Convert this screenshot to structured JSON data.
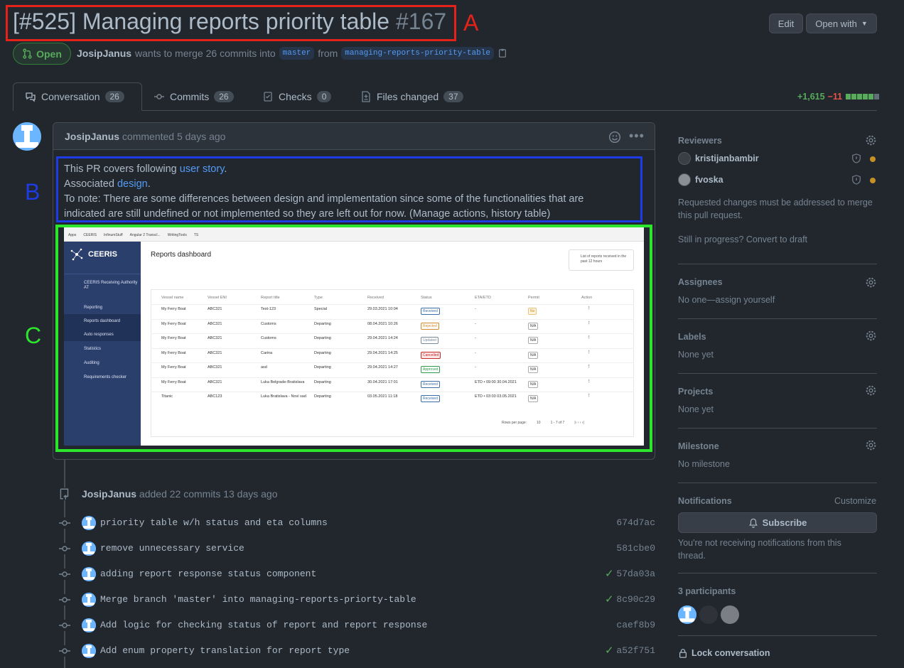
{
  "header": {
    "title": "[#525] Managing reports priority table",
    "number": "#167",
    "edit_label": "Edit",
    "open_with_label": "Open with",
    "state_label": "Open",
    "author": "JosipJanus",
    "merge_text_1": "wants to merge 26 commits into",
    "base_branch": "master",
    "merge_text_2": "from",
    "head_branch": "managing-reports-priority-table"
  },
  "annotations": {
    "a": "A",
    "b": "B",
    "c": "C"
  },
  "tabs": [
    {
      "label": "Conversation",
      "count": "26"
    },
    {
      "label": "Commits",
      "count": "26"
    },
    {
      "label": "Checks",
      "count": "0"
    },
    {
      "label": "Files changed",
      "count": "37"
    }
  ],
  "diffstat": {
    "additions": "+1,615",
    "deletions": "−11"
  },
  "comment": {
    "author": "JosipJanus",
    "meta": "commented 5 days ago",
    "line1_pre": "This PR covers following ",
    "line1_link": "user story",
    "line1_post": ".",
    "line2_pre": "Associated ",
    "line2_link": "design",
    "line2_post": ".",
    "line3": "To note: There are some differences between design and implementation since some of the functionalities that are",
    "line4": "indicated are still undefined or not implemented so they are left out for now. (Manage actions, history table)"
  },
  "embedded_screenshot": {
    "bookmarks": [
      "Apps",
      "CEERIS",
      "InfinumStuff",
      "Angular 2 Transcl...",
      "WritingTools",
      "TS"
    ],
    "brand": "CEERIS",
    "user": "CEERIS Receiving Authority AT",
    "sidebar": [
      "Reporting",
      "Reports dashboard",
      "Auto responses",
      "Statistics",
      "Auditing",
      "Requirements checker"
    ],
    "page_title": "Reports dashboard",
    "info": "List of reports received in the past 12 hours",
    "columns": [
      "Vessel name",
      "Vessel ENI",
      "Report title",
      "Type",
      "Received",
      "Status",
      "ETA/ETD",
      "Permit",
      "Action"
    ],
    "rows": [
      [
        "My Ferry Boat",
        "ABC321",
        "Test-123",
        "Special",
        "29.03.2021 10:04",
        "Received",
        "-",
        "No"
      ],
      [
        "My Ferry Boat",
        "ABC321",
        "Customs",
        "Departing",
        "08.04.2021 10:26",
        "Rejected",
        "-",
        "N/A"
      ],
      [
        "My Ferry Boat",
        "ABC321",
        "Customs",
        "Departing",
        "29.04.2021 14:24",
        "Updated",
        "-",
        "N/A"
      ],
      [
        "My Ferry Boat",
        "ABC321",
        "Carina",
        "Departing",
        "29.04.2021 14:25",
        "Cancelled",
        "-",
        "N/A"
      ],
      [
        "My Ferry Boat",
        "ABC321",
        "asd",
        "Departing",
        "29.04.2021 14:27",
        "Approved",
        "-",
        "N/A"
      ],
      [
        "My Ferry Boat",
        "ABC321",
        "Luka Belgrade-Bratislava",
        "Departing",
        "30.04.2021 17:01",
        "Received",
        "ETD • 09:00 30.04.2021",
        "N/A"
      ],
      [
        "Titanic",
        "ABC123",
        "Luka Bratislava - Novi sad",
        "Departing",
        "03.05.2021 11:18",
        "Received",
        "ETD • 03:03 03.05.2021",
        "N/A"
      ]
    ],
    "rows_per_page_label": "Rows per page:",
    "rows_per_page": "10",
    "range": "1 - 7 of 7"
  },
  "timeline": {
    "author": "JosipJanus",
    "event_text": "added 22 commits",
    "event_time": "13 days ago",
    "commits": [
      {
        "message": "priority table w/h status and eta columns",
        "sha": "674d7ac",
        "check": false
      },
      {
        "message": "remove unnecessary service",
        "sha": "581cbe0",
        "check": false
      },
      {
        "message": "adding report response status component",
        "sha": "57da03a",
        "check": true
      },
      {
        "message": "Merge branch 'master' into managing-reports-priorty-table",
        "sha": "8c90c29",
        "check": true
      },
      {
        "message": "Add logic for checking status of report and report response",
        "sha": "caef8b9",
        "check": false
      },
      {
        "message": "Add enum property translation for report type",
        "sha": "a52f751",
        "check": true
      }
    ]
  },
  "sidebar": {
    "reviewers_title": "Reviewers",
    "reviewers": [
      "kristijanbambir",
      "fvoska"
    ],
    "reviewers_note": "Requested changes must be addressed to merge this pull request.",
    "draft_text": "Still in progress? Convert to draft",
    "assignees_title": "Assignees",
    "assignees_value": "No one—assign yourself",
    "labels_title": "Labels",
    "labels_value": "None yet",
    "projects_title": "Projects",
    "projects_value": "None yet",
    "milestone_title": "Milestone",
    "milestone_value": "No milestone",
    "notifications_title": "Notifications",
    "customize_label": "Customize",
    "subscribe_label": "Subscribe",
    "notifications_note": "You're not receiving notifications from this thread.",
    "participants_title": "3 participants",
    "lock_label": "Lock conversation"
  },
  "colors": {
    "background": "#22272e",
    "accent": "#539bf5",
    "success": "#57ab5a",
    "danger": "#e5534b",
    "annotation_a": "#e5221a",
    "annotation_b": "#1d3be6",
    "annotation_c": "#2ce52c"
  }
}
